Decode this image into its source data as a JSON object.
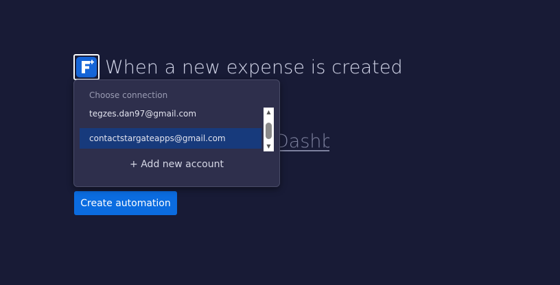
{
  "trigger": {
    "icon": "app-logo-f-icon",
    "title": "When a new expense is created"
  },
  "background_link": {
    "text": "Dashboard"
  },
  "connection_dropdown": {
    "header": "Choose connection",
    "options": [
      {
        "label": "tegzes.dan97@gmail.com",
        "selected": false
      },
      {
        "label": "contactstargateapps@gmail.com",
        "selected": true
      }
    ],
    "add_account_label": "+ Add new account"
  },
  "actions": {
    "create_label": "Create automation"
  },
  "colors": {
    "background": "#181b36",
    "dropdown_bg": "#2e2f4c",
    "selected_option": "#173a7c",
    "primary_button": "#0b6ce0",
    "app_icon": "#1565d8"
  }
}
